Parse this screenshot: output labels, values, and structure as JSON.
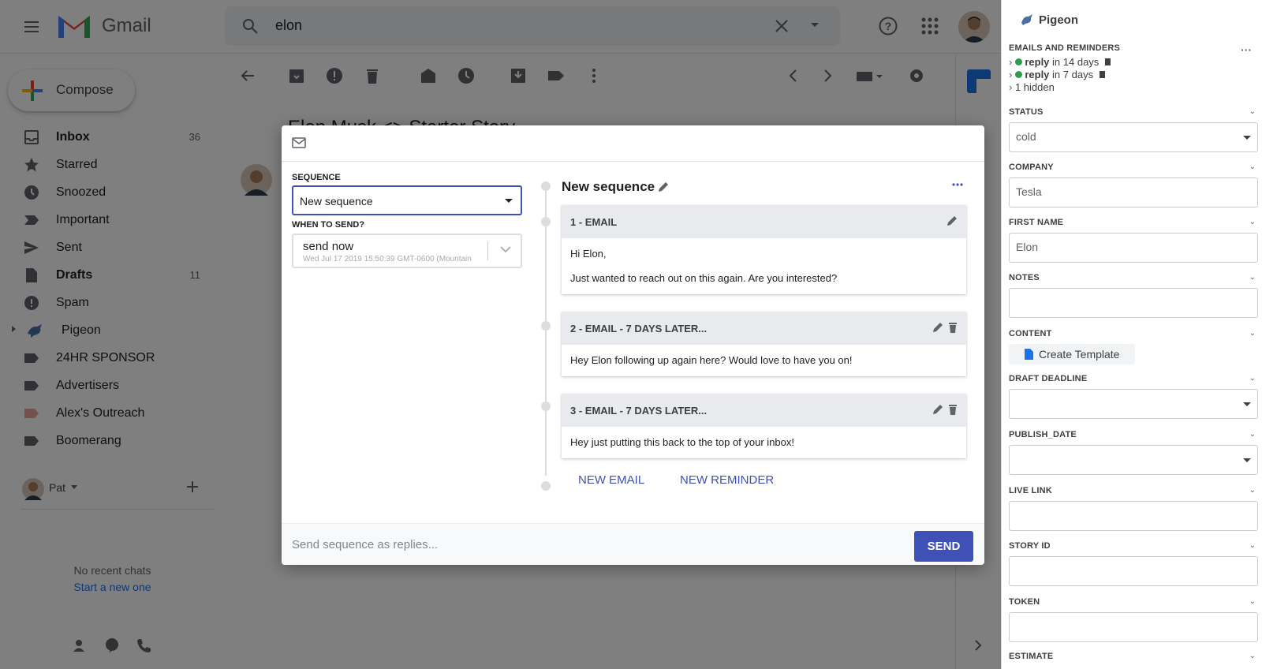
{
  "header": {
    "app_name": "Gmail",
    "search_value": "elon"
  },
  "sidebar": {
    "compose_label": "Compose",
    "items": [
      {
        "label": "Inbox",
        "count": "36"
      },
      {
        "label": "Starred",
        "count": ""
      },
      {
        "label": "Snoozed",
        "count": ""
      },
      {
        "label": "Important",
        "count": ""
      },
      {
        "label": "Sent",
        "count": ""
      },
      {
        "label": "Drafts",
        "count": "11"
      },
      {
        "label": "Spam",
        "count": ""
      },
      {
        "label": "Pigeon",
        "count": ""
      },
      {
        "label": "24HR SPONSOR",
        "count": ""
      },
      {
        "label": "Advertisers",
        "count": ""
      },
      {
        "label": "Alex's Outreach",
        "count": ""
      },
      {
        "label": "Boomerang",
        "count": ""
      }
    ],
    "user_name": "Pat",
    "no_chats": "No recent chats",
    "start_new": "Start a new one"
  },
  "email": {
    "subject": "Elon Musk <> Starter Story"
  },
  "modal": {
    "sequence_label": "SEQUENCE",
    "sequence_value": "New sequence",
    "when_label": "WHEN TO SEND?",
    "when_value": "send now",
    "when_date": "Wed Jul 17 2019 15:50:39 GMT-0600 (Mountain",
    "seq_title": "New sequence",
    "cards": [
      {
        "title": "1 - EMAIL",
        "lines": [
          "Hi Elon,",
          "Just wanted to reach out on this again. Are you interested?"
        ]
      },
      {
        "title": "2 - EMAIL - 7 DAYS LATER...",
        "lines": [
          "Hey Elon following up again here? Would love to have you on!"
        ]
      },
      {
        "title": "3 - EMAIL - 7 DAYS LATER...",
        "lines": [
          "Hey just putting this back to the top of your inbox!"
        ]
      }
    ],
    "new_email": "NEW EMAIL",
    "new_reminder": "NEW REMINDER",
    "footer_placeholder": "Send sequence as replies...",
    "send_label": "SEND"
  },
  "right_panel": {
    "title": "Pigeon",
    "reminders_label": "EMAILS AND REMINDERS",
    "reminders": [
      {
        "kind": "reply",
        "when": "in 14 days"
      },
      {
        "kind": "reply",
        "when": "in 7 days"
      }
    ],
    "hidden": "1 hidden",
    "status_label": "STATUS",
    "status_value": "cold",
    "company_label": "COMPANY",
    "company_value": "Tesla",
    "first_name_label": "FIRST NAME",
    "first_name_value": "Elon",
    "notes_label": "NOTES",
    "content_label": "CONTENT",
    "create_template": "Create Template",
    "draft_deadline_label": "DRAFT DEADLINE",
    "publish_date_label": "PUBLISH_DATE",
    "live_link_label": "LIVE LINK",
    "story_id_label": "STORY ID",
    "token_label": "TOKEN",
    "estimate_label": "ESTIMATE"
  },
  "colors": {
    "accent": "#3f51b5",
    "status_green": "#2e9d4f",
    "gmail_red": "#ea4335"
  }
}
